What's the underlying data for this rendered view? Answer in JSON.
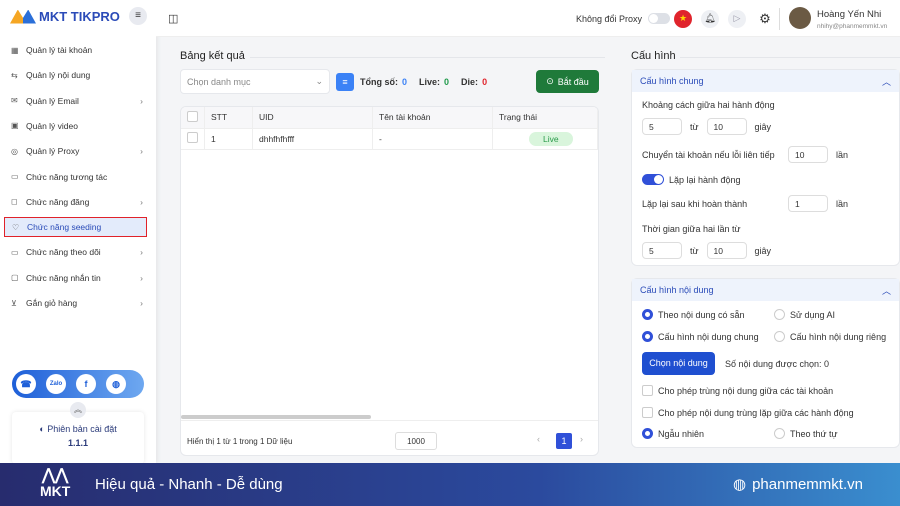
{
  "app": {
    "name": "MKT TIKPRO"
  },
  "sidebar": {
    "items": [
      {
        "label": "Quản lý tài khoản",
        "icon": "grid-icon",
        "chev": false
      },
      {
        "label": "Quản lý nội dung",
        "icon": "link-icon",
        "chev": false
      },
      {
        "label": "Quản lý Email",
        "icon": "mail-icon",
        "chev": true
      },
      {
        "label": "Quản lý video",
        "icon": "video-icon",
        "chev": false
      },
      {
        "label": "Quản lý Proxy",
        "icon": "proxy-icon",
        "chev": true
      },
      {
        "label": "Chức năng tương tác",
        "icon": "interact-icon",
        "chev": false
      },
      {
        "label": "Chức năng đăng",
        "icon": "post-icon",
        "chev": true
      },
      {
        "label": "Chức năng seeding",
        "icon": "seeding-icon",
        "chev": false
      },
      {
        "label": "Chức năng theo dõi",
        "icon": "follow-icon",
        "chev": true
      },
      {
        "label": "Chức năng nhắn tin",
        "icon": "message-icon",
        "chev": true
      },
      {
        "label": "Gắn giỏ hàng",
        "icon": "cart-icon",
        "chev": true
      }
    ],
    "version_label": "Phiên bản cài đặt",
    "version": "1.1.1"
  },
  "topbar": {
    "proxy_label": "Không đổi Proxy",
    "user_name": "Hoàng Yến Nhi",
    "user_email": "nhihy@phanmemmkt.vn"
  },
  "results": {
    "title": "Bảng kết quả",
    "category_placeholder": "Chọn danh mục",
    "total_label": "Tổng số:",
    "total": "0",
    "live_label": "Live:",
    "live": "0",
    "die_label": "Die:",
    "die": "0",
    "start_label": "Bắt đầu",
    "columns": [
      "STT",
      "UID",
      "Tên tài khoản",
      "Trạng thái"
    ],
    "rows": [
      {
        "stt": "1",
        "uid": "dhhfhfhfff",
        "name": "-",
        "status": "Live"
      }
    ],
    "footer": "Hiển thị 1 từ 1 trong 1 Dữ liệu",
    "page_size": "1000",
    "page": "1"
  },
  "config": {
    "title": "Cấu hình",
    "general": {
      "title": "Cấu hình chung",
      "interval_label": "Khoảng cách giữa hai hành động",
      "interval_from": "5",
      "interval_to": "10",
      "to_label": "từ",
      "sec_label": "giây",
      "switch_label": "Chuyển tài khoản nếu lỗi liên tiếp",
      "switch_value": "10",
      "times_label": "lần",
      "repeat_label": "Lặp lại hành động",
      "repeat_on": true,
      "repeat_after_label": "Lặp lại sau khi hoàn thành",
      "repeat_after_value": "1",
      "between_label": "Thời gian giữa hai lần từ",
      "between_from": "5",
      "between_to": "10"
    },
    "content": {
      "title": "Cấu hình nội dung",
      "opt_existing": "Theo nội dung có sẵn",
      "opt_ai": "Sử dụng AI",
      "opt_common": "Cấu hình nội dung chung",
      "opt_private": "Cấu hình nội dung riêng",
      "choose_label": "Chọn nội dung",
      "selected_label": "Số nội dung được chọn: 0",
      "allow_dup_accounts": "Cho phép trùng nội dung giữa các tài khoản",
      "allow_dup_actions": "Cho phép nội dung trùng lặp giữa các hành động",
      "random": "Ngẫu nhiên",
      "sequential": "Theo thứ tự"
    }
  },
  "banner": {
    "slogan": "Hiệu quả - Nhanh - Dễ dùng",
    "site": "phanmemmkt.vn",
    "logo_text": "MKT"
  },
  "colors": {
    "primary": "#3050d8",
    "start": "#1f7a3a",
    "banner_start": "#272c6e",
    "banner_end": "#3a8ecf"
  }
}
